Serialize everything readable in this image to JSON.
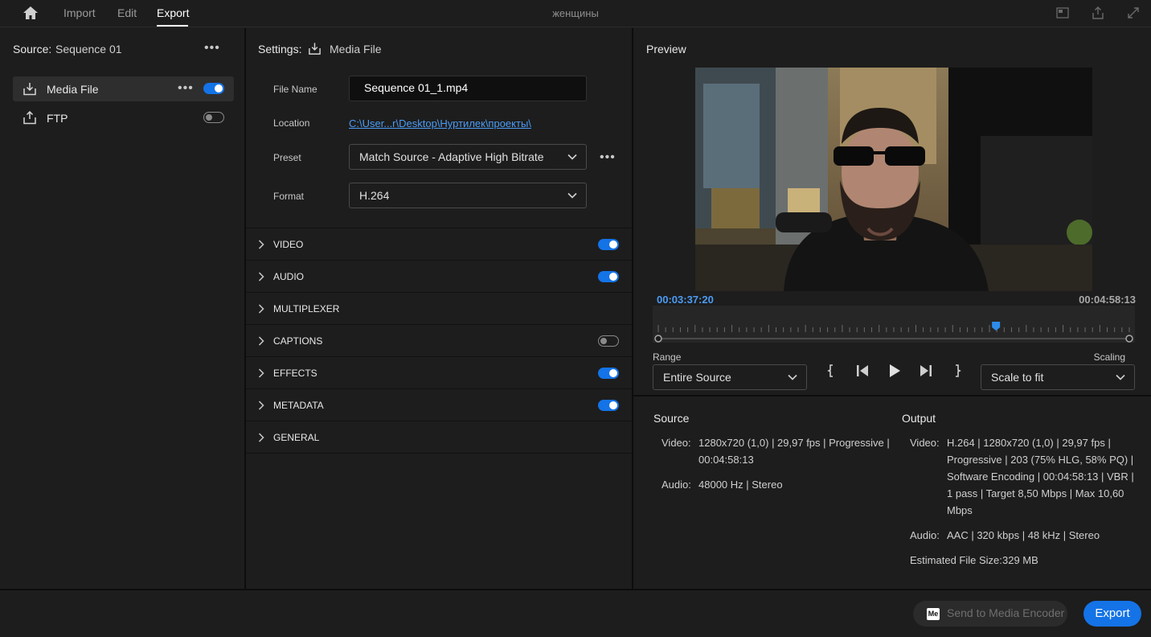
{
  "topbar": {
    "tabs": [
      "Import",
      "Edit",
      "Export"
    ],
    "active_tab": "Export",
    "title": "женщины"
  },
  "left": {
    "source_label": "Source:",
    "source_value": "Sequence 01",
    "destinations": [
      {
        "label": "Media File",
        "enabled": true
      },
      {
        "label": "FTP",
        "enabled": false
      }
    ]
  },
  "settings": {
    "label": "Settings:",
    "value": "Media File",
    "file_name_label": "File Name",
    "file_name": "Sequence 01_1.mp4",
    "location_label": "Location",
    "location": "C:\\User...r\\Desktop\\Нуртилек\\проекты\\",
    "preset_label": "Preset",
    "preset": "Match Source - Adaptive High Bitrate",
    "format_label": "Format",
    "format": "H.264",
    "sections": [
      {
        "label": "VIDEO",
        "toggle": "on"
      },
      {
        "label": "AUDIO",
        "toggle": "on"
      },
      {
        "label": "MULTIPLEXER",
        "toggle": "none"
      },
      {
        "label": "CAPTIONS",
        "toggle": "off"
      },
      {
        "label": "EFFECTS",
        "toggle": "on"
      },
      {
        "label": "METADATA",
        "toggle": "on"
      },
      {
        "label": "GENERAL",
        "toggle": "none"
      }
    ]
  },
  "preview": {
    "label": "Preview",
    "current_time": "00:03:37:20",
    "duration": "00:04:58:13",
    "playhead_fraction": 0.717,
    "range_label": "Range",
    "range_value": "Entire Source",
    "scaling_label": "Scaling",
    "scaling_value": "Scale to fit"
  },
  "source_info": {
    "heading": "Source",
    "video_key": "Video:",
    "video_lines": [
      "1280x720 (1,0)  |  29,97 fps  |  Progressive  |",
      "00:04:58:13"
    ],
    "audio_key": "Audio:",
    "audio_value": "48000 Hz  |  Stereo"
  },
  "output_info": {
    "heading": "Output",
    "video_key": "Video:",
    "video_lines": [
      "H.264  |  1280x720 (1,0)  |  29,97 fps  |",
      "Progressive  |  203 (75% HLG, 58% PQ)  |",
      "Software Encoding  |  00:04:58:13   |  VBR  |",
      " 1 pass  |  Target 8,50 Mbps  |  Max 10,60",
      "Mbps"
    ],
    "audio_key": "Audio:",
    "audio_value": "AAC  |  320 kbps  |  48 kHz  |  Stereo",
    "size_key": "Estimated File Size:",
    "size_value": "329 MB"
  },
  "bottom": {
    "send_label": "Send to Media Encoder",
    "send_icon_text": "Me",
    "export_label": "Export"
  },
  "colors": {
    "accent": "#1473e6",
    "link": "#4b9cf5",
    "bg": "#1d1d1d"
  }
}
